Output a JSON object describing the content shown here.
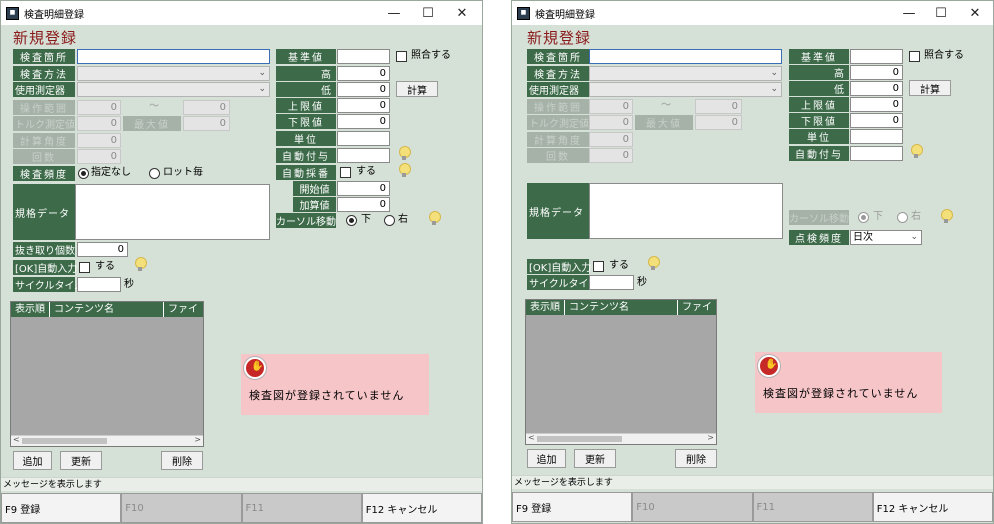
{
  "windows": [
    {
      "title": "検査明細登録",
      "app_icon": "app-icon",
      "heading": "新規登録",
      "left_fields": {
        "kensa_basho": {
          "label": "検査箇所",
          "value": ""
        },
        "kensa_houhou": {
          "label": "検査方法",
          "value": ""
        },
        "shiyou_sokuteiki": {
          "label": "使用測定器",
          "value": ""
        },
        "sousa_hanni": {
          "label": "操作範囲",
          "from": "0",
          "tilde": "〜",
          "to": "0"
        },
        "torque": {
          "label": "トルク測定値",
          "value": "0",
          "label2": "最大値",
          "value2": "0"
        },
        "keisan_kakudo": {
          "label": "計算角度",
          "value": "0"
        },
        "kaisuu": {
          "label": "回数",
          "value": "0"
        },
        "kensa_hindo": {
          "label": "検査頻度",
          "opt1": "指定なし",
          "opt2": "ロット毎"
        },
        "kikaku_data": {
          "label": "規格データ",
          "value": ""
        },
        "nukitori": {
          "label": "抜き取り個数",
          "value": "0"
        },
        "ok_jidou": {
          "label": "[OK]自動入力",
          "check_label": "する"
        },
        "cycle_time": {
          "label": "サイクルタイム",
          "value": "",
          "unit": "秒"
        }
      },
      "right_fields": {
        "kijunchi": {
          "label": "基準値",
          "value": "",
          "check_label": "照合する"
        },
        "taka": {
          "label": "高",
          "value": "0"
        },
        "hiku": {
          "label": "低",
          "value": "0",
          "button": "計算"
        },
        "jougenchi": {
          "label": "上限値",
          "value": "0"
        },
        "kagenchi": {
          "label": "下限値",
          "value": "0"
        },
        "tani": {
          "label": "単位",
          "value": ""
        },
        "jidou_fuyo": {
          "label": "自動付与",
          "value": ""
        },
        "jidou_saiban": {
          "label": "自動採番",
          "check_label": "する"
        },
        "kaishichi": {
          "label": "開始値",
          "value": "0"
        },
        "kasanchi": {
          "label": "加算値",
          "value": "0"
        },
        "cursor_idou": {
          "label": "カーソル移動",
          "opt1": "下",
          "opt2": "右"
        }
      },
      "grid": {
        "columns": [
          "表示順",
          "コンテンツ名",
          "ファイ"
        ]
      },
      "alert_message": "検査図が登録されていません",
      "buttons": {
        "add": "追加",
        "update": "更新",
        "delete": "削除"
      },
      "status": "メッセージを表示します",
      "fkeys": [
        "F9 登録",
        "F10",
        "F11",
        "F12 キャンセル"
      ]
    },
    {
      "title": "検査明細登録",
      "app_icon": "app-icon",
      "heading": "新規登録",
      "left_fields": {
        "kensa_basho": {
          "label": "検査箇所",
          "value": ""
        },
        "kensa_houhou": {
          "label": "検査方法",
          "value": ""
        },
        "shiyou_sokuteiki": {
          "label": "使用測定器",
          "value": ""
        },
        "sousa_hanni": {
          "label": "操作範囲",
          "from": "0",
          "tilde": "〜",
          "to": "0"
        },
        "torque": {
          "label": "トルク測定値",
          "value": "0",
          "label2": "最大値",
          "value2": "0"
        },
        "keisan_kakudo": {
          "label": "計算角度",
          "value": "0"
        },
        "kaisuu": {
          "label": "回数",
          "value": "0"
        },
        "kikaku_data": {
          "label": "規格データ",
          "value": ""
        },
        "ok_jidou": {
          "label": "[OK]自動入力",
          "check_label": "する"
        },
        "cycle_time": {
          "label": "サイクルタイム",
          "value": "",
          "unit": "秒"
        }
      },
      "right_fields": {
        "kijunchi": {
          "label": "基準値",
          "value": "",
          "check_label": "照合する"
        },
        "taka": {
          "label": "高",
          "value": "0"
        },
        "hiku": {
          "label": "低",
          "value": "0",
          "button": "計算"
        },
        "jougenchi": {
          "label": "上限値",
          "value": "0"
        },
        "kagenchi": {
          "label": "下限値",
          "value": "0"
        },
        "tani": {
          "label": "単位",
          "value": ""
        },
        "jidou_fuyo": {
          "label": "自動付与",
          "value": ""
        },
        "cursor_idou": {
          "label": "カーソル移動",
          "opt1": "下",
          "opt2": "右"
        },
        "tenken_hindo": {
          "label": "点検頻度",
          "value": "日次"
        }
      },
      "grid": {
        "columns": [
          "表示順",
          "コンテンツ名",
          "ファイ"
        ]
      },
      "alert_message": "検査図が登録されていません",
      "buttons": {
        "add": "追加",
        "update": "更新",
        "delete": "削除"
      },
      "status": "メッセージを表示します",
      "fkeys": [
        "F9 登録",
        "F10",
        "F11",
        "F12 キャンセル"
      ]
    }
  ],
  "window_controls": {
    "minimize": "—",
    "maximize": "☐",
    "close": "✕"
  }
}
